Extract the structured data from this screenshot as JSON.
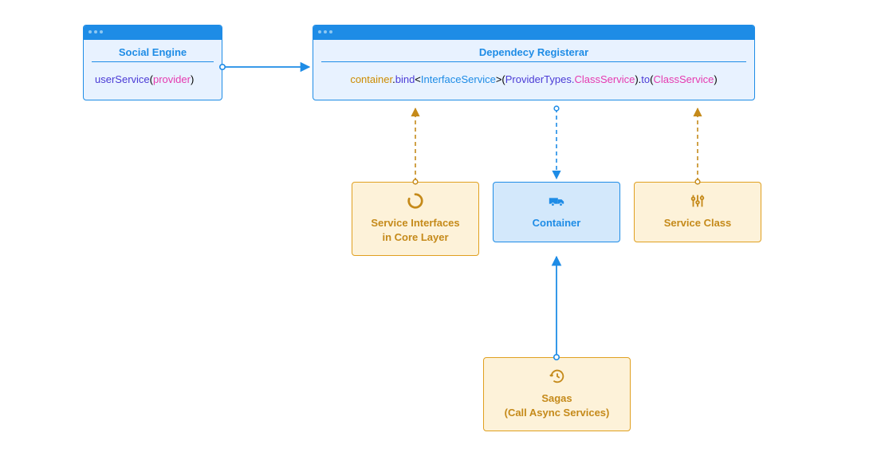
{
  "windows": {
    "social": {
      "title": "Social Engine",
      "code": {
        "func": "userService",
        "open": "(",
        "arg": "provider",
        "close": ")"
      }
    },
    "registrar": {
      "title": "Dependecy Registerar",
      "code": {
        "t0": "container",
        "t1": ".",
        "t2": "bind",
        "t3": "<",
        "t4": "InterfaceService",
        "t5": ">(",
        "t6": "ProviderTypes.",
        "t7": "ClassService",
        "t8": ").",
        "t9": "to",
        "t10": "(",
        "t11": "ClassService",
        "t12": ")"
      }
    }
  },
  "cards": {
    "interfaces": "Service Interfaces\nin Core Layer",
    "container": "Container",
    "serviceClass": "Service Class",
    "sagas": "Sagas\n(Call Async Services)"
  },
  "colors": {
    "windowBorder": "#1e8ce6",
    "amberBorder": "#e0a020",
    "pink": "#e63ab0"
  }
}
